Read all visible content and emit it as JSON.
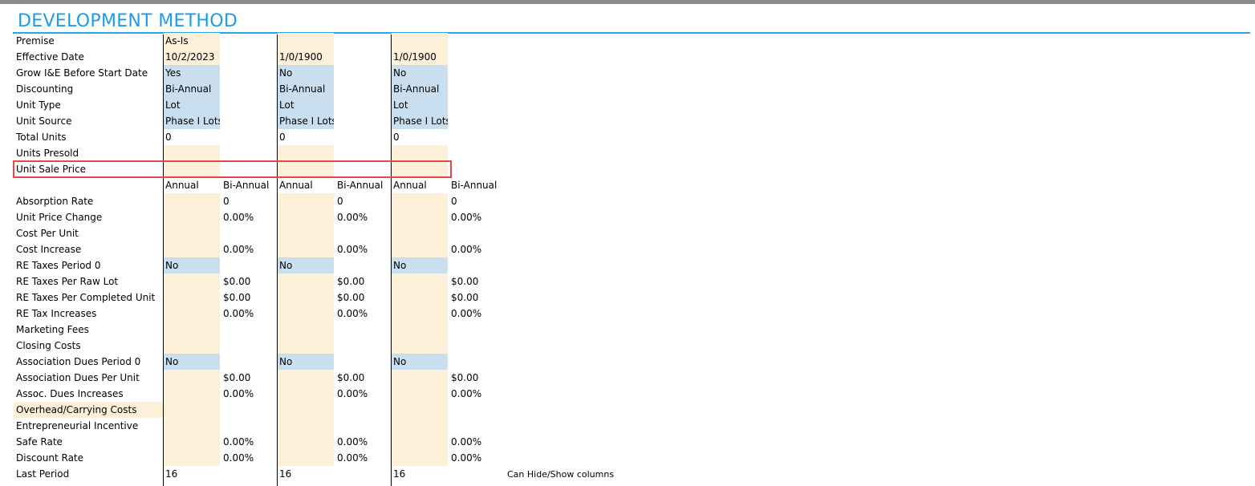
{
  "section": {
    "title": "DEVELOPMENT METHOD",
    "note": "Can Hide/Show columns"
  },
  "rows": {
    "premise": "Premise",
    "effective_date": "Effective Date",
    "grow_ie": "Grow I&E Before Start Date",
    "discounting": "Discounting",
    "unit_type": "Unit Type",
    "unit_source": "Unit Source",
    "total_units": "Total Units",
    "units_presold": "Units Presold",
    "unit_sale_price": "Unit Sale Price",
    "absorption_rate": "Absorption Rate",
    "unit_price_change": "Unit Price Change",
    "cost_per_unit": "Cost Per Unit",
    "cost_increase": "Cost Increase",
    "re_taxes_period0": "RE Taxes Period 0",
    "re_taxes_raw_lot": "RE Taxes Per Raw Lot",
    "re_taxes_completed": "RE Taxes Per Completed Unit",
    "re_tax_increases": "RE Tax Increases",
    "marketing_fees": "Marketing Fees",
    "closing_costs": "Closing Costs",
    "assoc_dues_period0": "Association Dues Period 0",
    "assoc_dues_per_unit": "Association Dues Per Unit",
    "assoc_dues_increases": "Assoc. Dues Increases",
    "overhead": "Overhead/Carrying Costs",
    "entrepreneurial": "Entrepreneurial Incentive",
    "safe_rate": "Safe Rate",
    "discount_rate": "Discount Rate",
    "last_period": "Last Period"
  },
  "columns": [
    {
      "premise": "As-Is",
      "effective_date": "10/2/2023",
      "grow_ie": "Yes",
      "discounting": "Bi-Annual",
      "unit_type": "Lot",
      "unit_source": "Phase I Lots",
      "total_units": "0",
      "hdr_annual": "Annual",
      "hdr_biannual": "Bi-Annual",
      "absorption_rate": "0",
      "unit_price_change": "0.00%",
      "cost_increase": "0.00%",
      "re_taxes_period0": "No",
      "re_taxes_raw_lot": "$0.00",
      "re_taxes_completed": "$0.00",
      "re_tax_increases": "0.00%",
      "assoc_dues_period0": "No",
      "assoc_dues_per_unit": "$0.00",
      "assoc_dues_increases": "0.00%",
      "safe_rate": "0.00%",
      "discount_rate": "0.00%",
      "last_period": "16"
    },
    {
      "premise": "",
      "effective_date": "1/0/1900",
      "grow_ie": "No",
      "discounting": "Bi-Annual",
      "unit_type": "Lot",
      "unit_source": "Phase I Lots",
      "total_units": "0",
      "hdr_annual": "Annual",
      "hdr_biannual": "Bi-Annual",
      "absorption_rate": "0",
      "unit_price_change": "0.00%",
      "cost_increase": "0.00%",
      "re_taxes_period0": "No",
      "re_taxes_raw_lot": "$0.00",
      "re_taxes_completed": "$0.00",
      "re_tax_increases": "0.00%",
      "assoc_dues_period0": "No",
      "assoc_dues_per_unit": "$0.00",
      "assoc_dues_increases": "0.00%",
      "safe_rate": "0.00%",
      "discount_rate": "0.00%",
      "last_period": "16"
    },
    {
      "premise": "",
      "effective_date": "1/0/1900",
      "grow_ie": "No",
      "discounting": "Bi-Annual",
      "unit_type": "Lot",
      "unit_source": "Phase I Lots",
      "total_units": "0",
      "hdr_annual": "Annual",
      "hdr_biannual": "Bi-Annual",
      "absorption_rate": "0",
      "unit_price_change": "0.00%",
      "cost_increase": "0.00%",
      "re_taxes_period0": "No",
      "re_taxes_raw_lot": "$0.00",
      "re_taxes_completed": "$0.00",
      "re_tax_increases": "0.00%",
      "assoc_dues_period0": "No",
      "assoc_dues_per_unit": "$0.00",
      "assoc_dues_increases": "0.00%",
      "safe_rate": "0.00%",
      "discount_rate": "0.00%",
      "last_period": "16"
    }
  ],
  "colors": {
    "title": "#1e9be6",
    "input_tan": "#fdefd8",
    "input_blue": "#c9dff0",
    "highlight": "#e04a4a"
  }
}
